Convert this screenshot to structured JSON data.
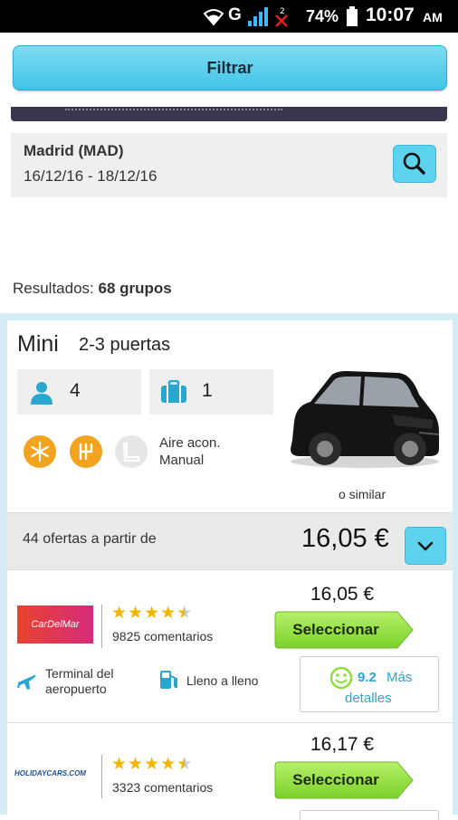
{
  "status_bar": {
    "network": "G",
    "battery": "74%",
    "time": "10:07",
    "ampm": "AM"
  },
  "filter_button": {
    "label": "Filtrar"
  },
  "search": {
    "location": "Madrid (MAD)",
    "dates": "16/12/16 - 18/12/16"
  },
  "results": {
    "prefix": "Resultados:",
    "count": "68 grupos"
  },
  "car": {
    "category": "Mini",
    "doors": "2-3 puertas",
    "passengers": "4",
    "bags": "1",
    "features_line1": "Aire acon.",
    "features_line2": "Manual",
    "similar": "o similar",
    "offers_text": "44 ofertas a partir de",
    "from_price": "16,05 €"
  },
  "offers": [
    {
      "supplier": "CarDelMar",
      "price": "16,05 €",
      "rating": 4.5,
      "reviews": "9825 comentarios",
      "select_label": "Seleccionar",
      "pickup_line1": "Terminal del",
      "pickup_line2": "aeropuerto",
      "fuel_policy": "Lleno a lleno",
      "score": "9.2",
      "more_label_1": "Más",
      "more_label_2": "detalles"
    },
    {
      "supplier": "HOLIDAYCARS.COM",
      "price": "16,17 €",
      "rating": 4.5,
      "reviews": "3323 comentarios",
      "select_label": "Seleccionar"
    }
  ],
  "colors": {
    "accent": "#5dd3ee",
    "select_green": "#8fe03c",
    "star": "#f2b600",
    "link": "#2aa7cf",
    "icon_blue": "#2aa7cf",
    "feature_orange": "#f3a31d"
  }
}
